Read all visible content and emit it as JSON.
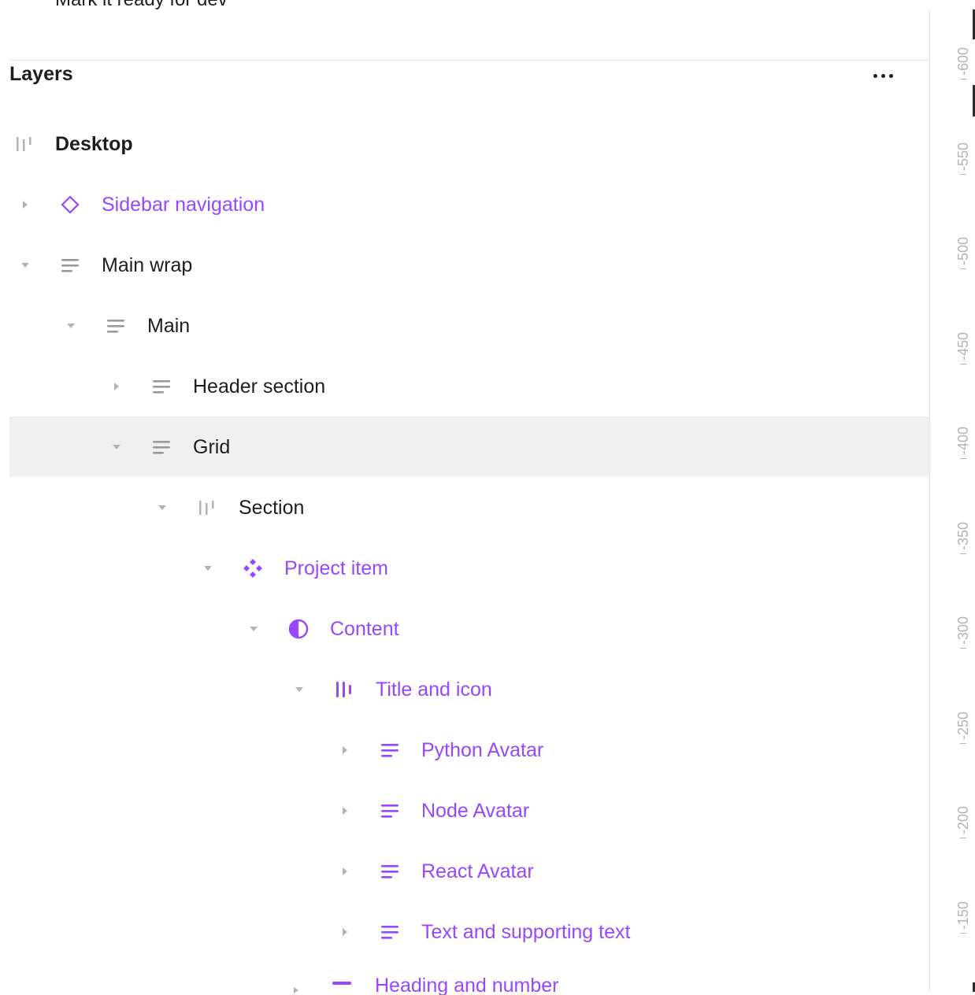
{
  "top_partial_text": "Mark it ready for dev",
  "panel": {
    "title": "Layers",
    "more_icon": "more-horizontal-icon"
  },
  "layers": [
    {
      "label": "Desktop",
      "icon": "frame-icon",
      "caret": "none",
      "color": "#1e1e1e",
      "depth": 0,
      "bold": true,
      "selected": false
    },
    {
      "label": "Sidebar navigation",
      "icon": "instance-icon",
      "caret": "collapsed",
      "color": "#9747ff",
      "depth": 1,
      "bold": false,
      "selected": false
    },
    {
      "label": "Main wrap",
      "icon": "autolayout-vertical-icon",
      "caret": "expanded",
      "color": "#1e1e1e",
      "depth": 1,
      "bold": false,
      "selected": false
    },
    {
      "label": "Main",
      "icon": "autolayout-vertical-icon",
      "caret": "expanded",
      "color": "#1e1e1e",
      "depth": 2,
      "bold": false,
      "selected": false
    },
    {
      "label": "Header section",
      "icon": "autolayout-vertical-icon",
      "caret": "collapsed",
      "color": "#1e1e1e",
      "depth": 3,
      "bold": false,
      "selected": false
    },
    {
      "label": "Grid",
      "icon": "autolayout-vertical-icon",
      "caret": "expanded",
      "color": "#1e1e1e",
      "depth": 3,
      "bold": false,
      "selected": true
    },
    {
      "label": "Section",
      "icon": "frame-icon",
      "caret": "expanded",
      "color": "#1e1e1e",
      "depth": 4,
      "bold": false,
      "selected": false
    },
    {
      "label": "Project item",
      "icon": "component-icon",
      "caret": "expanded",
      "color": "#9747ff",
      "depth": 5,
      "bold": false,
      "selected": false
    },
    {
      "label": "Content",
      "icon": "boolean-icon",
      "caret": "expanded",
      "color": "#9747ff",
      "depth": 6,
      "bold": false,
      "selected": false
    },
    {
      "label": "Title and icon",
      "icon": "autolayout-horizontal-icon",
      "caret": "expanded",
      "color": "#9747ff",
      "depth": 7,
      "bold": false,
      "selected": false
    },
    {
      "label": "Python Avatar",
      "icon": "autolayout-vertical-icon",
      "caret": "collapsed",
      "color": "#9747ff",
      "depth": 8,
      "bold": false,
      "selected": false
    },
    {
      "label": "Node Avatar",
      "icon": "autolayout-vertical-icon",
      "caret": "collapsed",
      "color": "#9747ff",
      "depth": 8,
      "bold": false,
      "selected": false
    },
    {
      "label": "React Avatar",
      "icon": "autolayout-vertical-icon",
      "caret": "collapsed",
      "color": "#9747ff",
      "depth": 8,
      "bold": false,
      "selected": false
    },
    {
      "label": "Text and supporting text",
      "icon": "autolayout-vertical-icon",
      "caret": "collapsed",
      "color": "#9747ff",
      "depth": 8,
      "bold": false,
      "selected": false
    }
  ],
  "bottom_partial_layer": {
    "label": "Heading and number",
    "icon": "autolayout-vertical-icon",
    "color": "#9747ff"
  },
  "ruler": {
    "orientation": "vertical",
    "labels": [
      "-600",
      "-550",
      "-500",
      "-450",
      "-400",
      "-350",
      "-300",
      "-250",
      "-200",
      "-150"
    ]
  },
  "colors": {
    "component_purple": "#9747ff",
    "text_dark": "#1e1e1e",
    "selected_row_bg": "#f0f0f0",
    "ruler_text": "#b3b3b3"
  }
}
